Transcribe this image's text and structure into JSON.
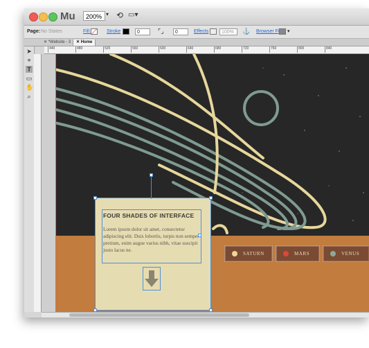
{
  "app": {
    "name": "Mu",
    "zoom": "200%"
  },
  "control_bar": {
    "page_label": "Page:",
    "page_value": "No States",
    "fill_label": "Fill:",
    "stroke_label": "Stroke",
    "stroke_width": "0",
    "corner_value": "0",
    "effects_label": "Effects",
    "opacity_value": "100%",
    "browser_fill_label": "Browser Fill:"
  },
  "tabs": [
    {
      "label": "*Website - 3"
    },
    {
      "label": "Home"
    }
  ],
  "ruler_ticks": [
    "440",
    "480",
    "520",
    "560",
    "600",
    "640",
    "680",
    "720",
    "760",
    "800",
    "840"
  ],
  "card": {
    "title": "FOUR SHADES OF INTERFACE",
    "body": "Lorem ipsum dolor sit amet, consectetur adipiscing elit. Duis lobortis, turpis non semper pretium, enim augue varius nibh, vitae suscipit justo lacus ne."
  },
  "nav": [
    {
      "label": "SATURN",
      "color": "#eed49c"
    },
    {
      "label": "MARS",
      "color": "#e0453a"
    },
    {
      "label": "VENUS",
      "color": "#8ea79c"
    }
  ],
  "colors": {
    "space": "#272727",
    "ground": "#c17c3e",
    "ring_yellow": "#e6d79b",
    "ring_teal": "#7f9b91",
    "card": "#e6dcb2"
  }
}
